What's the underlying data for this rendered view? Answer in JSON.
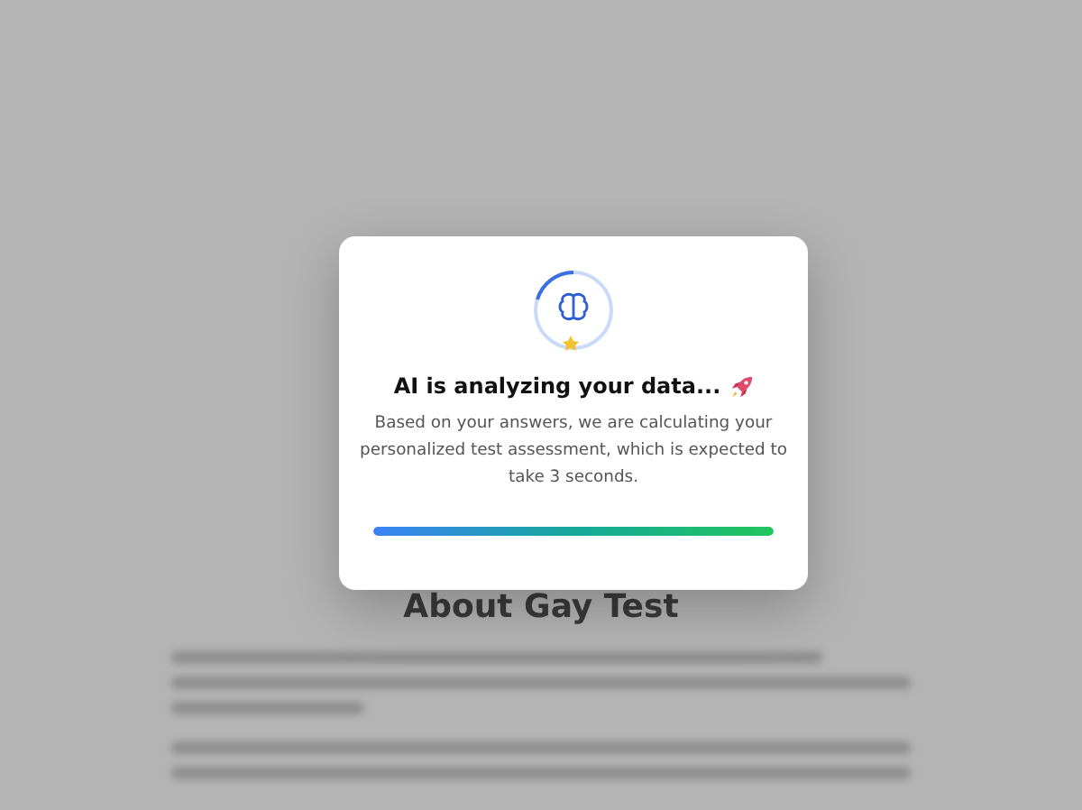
{
  "background": {
    "heading": "About Gay Test"
  },
  "dialog": {
    "title": "AI is analyzing your data...",
    "message": "Based on your answers, we are calculating your personalized test assessment, which is expected to take 3 seconds.",
    "progress": {
      "level": 1.0
    }
  }
}
